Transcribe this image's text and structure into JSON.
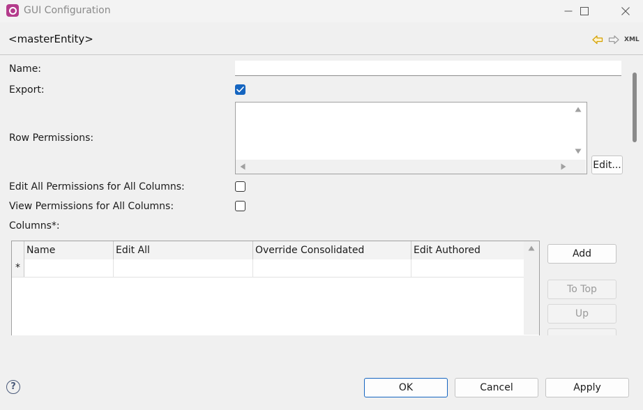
{
  "window": {
    "title": "GUI Configuration"
  },
  "header": {
    "entity_title": "<masterEntity>",
    "xml_label": "XML"
  },
  "form": {
    "name_label": "Name:",
    "name_value": "",
    "export_label": "Export:",
    "export_checked": true,
    "row_permissions_label": "Row Permissions:",
    "edit_button": "Edit...",
    "edit_all_permissions_label": "Edit All Permissions for All Columns:",
    "edit_all_permissions_checked": false,
    "view_permissions_label": "View Permissions for All Columns:",
    "view_permissions_checked": false,
    "columns_label": "Columns*:"
  },
  "columns_table": {
    "headers": [
      "Name",
      "Edit All",
      "Override Consolidated",
      "Edit Authored"
    ],
    "new_row_marker": "*"
  },
  "side_buttons": {
    "add": "Add",
    "to_top": "To Top",
    "up": "Up"
  },
  "footer": {
    "ok": "OK",
    "cancel": "Cancel",
    "apply": "Apply",
    "help": "?"
  },
  "colors": {
    "accent": "#1565c0",
    "app_icon": "#b43c8c"
  }
}
